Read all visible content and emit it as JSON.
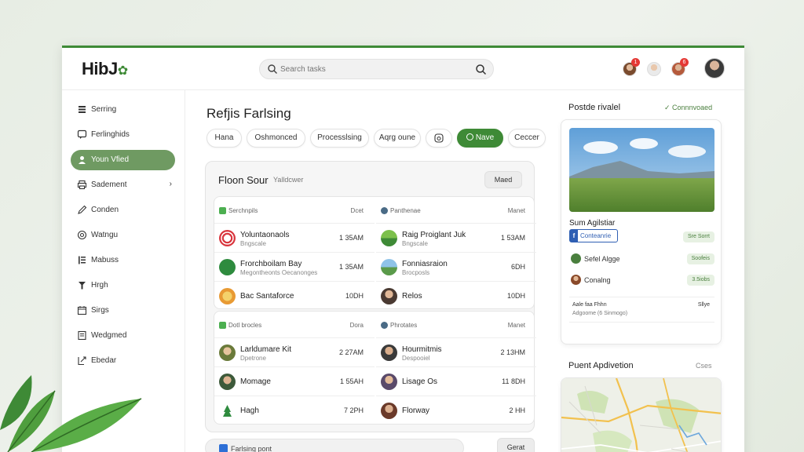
{
  "app": {
    "logo": "HibJ"
  },
  "header": {
    "search_placeholder": "Search tasks",
    "badges": [
      "1",
      "6"
    ]
  },
  "sidebar": {
    "items": [
      {
        "label": "Serring",
        "icon": "stack-icon"
      },
      {
        "label": "Ferlinghids",
        "icon": "chat-icon"
      },
      {
        "label": "Youn Vfied",
        "icon": "user-icon"
      },
      {
        "label": "Sadement",
        "icon": "printer-icon"
      },
      {
        "label": "Conden",
        "icon": "pen-icon"
      },
      {
        "label": "Watngu",
        "icon": "at-icon"
      },
      {
        "label": "Mabuss",
        "icon": "list-icon"
      },
      {
        "label": "Hrgh",
        "icon": "pin-icon"
      },
      {
        "label": "Sirgs",
        "icon": "calendar-icon"
      },
      {
        "label": "Wedgmed",
        "icon": "doc-icon"
      },
      {
        "label": "Ebedar",
        "icon": "export-icon"
      }
    ]
  },
  "main": {
    "title": "Refjis Farlsing",
    "chips": [
      "Hana",
      "Oshmonced",
      "Processlsing",
      "Aqrg oune",
      "",
      "Nave",
      "Ceccer"
    ],
    "panel": {
      "title": "Floon Sour",
      "subtitle": "Yalldcwer",
      "button": "Maed",
      "sections": [
        {
          "left": {
            "label": "Serchnpils",
            "time_label": "Dcet",
            "rows": [
              {
                "name": "Yoluntaonaols",
                "sub": "Bngscale",
                "time": "1 35AM"
              },
              {
                "name": "Frorchboilam Bay",
                "sub": "Megontheonts Oecanonges",
                "time": "1 35AM"
              },
              {
                "name": "Bac Santaforce",
                "sub": "",
                "time": "10DH"
              }
            ]
          },
          "right": {
            "label": "Panthenae",
            "time_label": "Manet",
            "rows": [
              {
                "name": "Raig Proiglant Juk",
                "sub": "Bngscale",
                "time": "1 53AM"
              },
              {
                "name": "Fonniasraion",
                "sub": "Brocposls",
                "time": "6DH"
              },
              {
                "name": "Relos",
                "sub": "",
                "time": "10DH"
              }
            ]
          }
        },
        {
          "left": {
            "label": "Dotl brocles",
            "time_label": "Dora",
            "rows": [
              {
                "name": "Larldumare Kit",
                "sub": "Dpetrone",
                "time": "2 27AM"
              },
              {
                "name": "Momage",
                "sub": "",
                "time": "1 55AH"
              },
              {
                "name": "Hagh",
                "sub": "",
                "time": "7 2PH"
              }
            ]
          },
          "right": {
            "label": "Phrotates",
            "time_label": "Manet",
            "rows": [
              {
                "name": "Hourmitmis",
                "sub": "Despooiel",
                "time": "2 13HM"
              },
              {
                "name": "Lisage Os",
                "sub": "",
                "time": "11 8DH"
              },
              {
                "name": "Florway",
                "sub": "",
                "time": "2 HH"
              }
            ]
          }
        }
      ]
    },
    "bottom_bar_label": "Farlsing pont",
    "bottom_button": "Gerat"
  },
  "right": {
    "title": "Postde rivalel",
    "link": "Connnvoaed",
    "card": {
      "name": "Sum Agilstiar",
      "fb_label": "Conteanrie",
      "fb_pill": "Sre Sorrt",
      "rows": [
        {
          "label": "Sefel Algge",
          "pill": "Soofeis"
        },
        {
          "label": "Conalng",
          "pill": "3.5iobs"
        }
      ],
      "note_line1": "Aale faa Fhhn",
      "note_line2": "Adgoome (6 Sinmogo)",
      "note_right": "Sllye"
    },
    "title2": "Puent Apdivetion",
    "link2": "Cses"
  },
  "colors": {
    "accent": "#3e8a36",
    "active_sidebar": "#6f9a62",
    "badge": "#e53935"
  }
}
